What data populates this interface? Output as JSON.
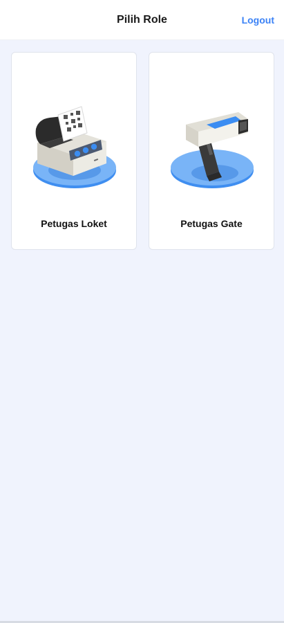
{
  "header": {
    "title": "Pilih Role",
    "logout_label": "Logout"
  },
  "roles": [
    {
      "label": "Petugas Loket",
      "icon": "receipt-printer-icon"
    },
    {
      "label": "Petugas Gate",
      "icon": "barcode-scanner-icon"
    }
  ],
  "colors": {
    "accent": "#3b82f6",
    "background": "#f0f3fd",
    "card": "#ffffff"
  }
}
